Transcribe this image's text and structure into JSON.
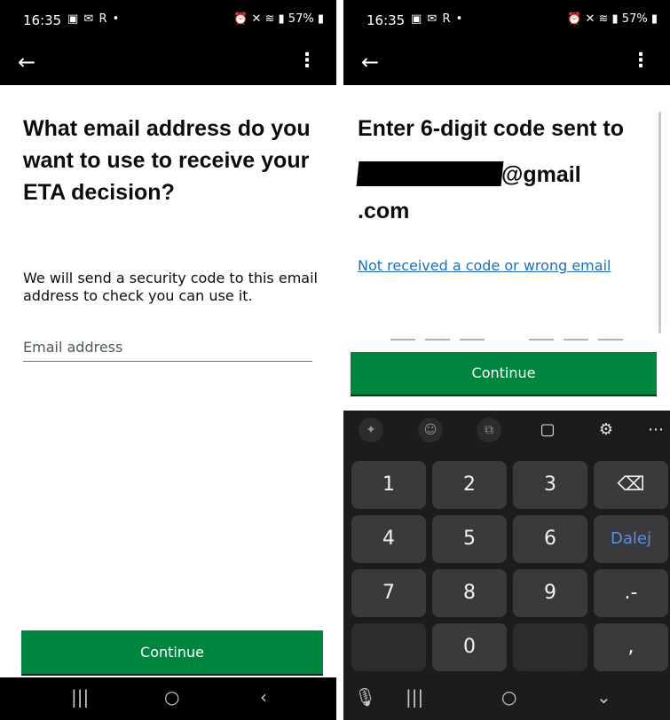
{
  "status_bar": {
    "time": "16:35",
    "left_icons": "■ ✉ R •",
    "battery": "57%",
    "right_icons": "⏰ ✕ ⌗ 57%"
  },
  "left_screen": {
    "heading": "What email address do you want to use to receive your ETA decision?",
    "body": "We will send a security code to this email address to check you can use it.",
    "email_placeholder": "Email address",
    "continue_label": "Continue"
  },
  "right_screen": {
    "heading": "Enter 6-digit code sent to",
    "email_suffix": "@gmail",
    "email_tld": ".com",
    "resend_link": "Not received a code or wrong email",
    "continue_label": "Continue",
    "code_digits": 6
  },
  "keyboard": {
    "keys": {
      "k1": "1",
      "k2": "2",
      "k3": "3",
      "k4": "4",
      "k5": "5",
      "k6": "6",
      "k7": "7",
      "k8": "8",
      "k9": "9",
      "k0": "0",
      "next": "Dalej",
      "minus": ".-",
      "comma": ","
    },
    "toolbar_icons": [
      "sparkle-icon",
      "emoji-icon",
      "sticker-icon",
      "clipboard-icon",
      "settings-icon",
      "more-icon"
    ]
  },
  "colors": {
    "continue_green": "#00853f",
    "link_blue": "#1d70b8",
    "text_dark": "#0b0c0c"
  }
}
